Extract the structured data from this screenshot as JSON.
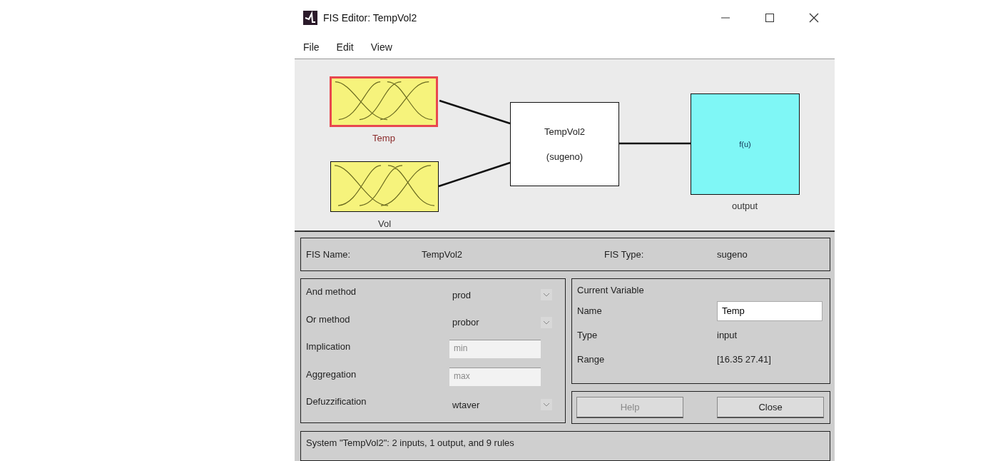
{
  "window": {
    "title": "FIS Editor: TempVol2"
  },
  "menu": [
    "File",
    "Edit",
    "View"
  ],
  "diagram": {
    "inputs": [
      {
        "name": "Temp",
        "selected": true
      },
      {
        "name": "Vol",
        "selected": false
      }
    ],
    "system": {
      "name": "TempVol2",
      "type": "(sugeno)"
    },
    "output": {
      "function": "f(u)",
      "name": "output",
      "selected": false
    }
  },
  "fis": {
    "name_label": "FIS Name:",
    "name": "TempVol2",
    "type_label": "FIS Type:",
    "type": "sugeno"
  },
  "methods": [
    {
      "label": "And method",
      "value": "prod",
      "disabled": false
    },
    {
      "label": "Or method",
      "value": "probor",
      "disabled": false
    },
    {
      "label": "Implication",
      "value": "min",
      "disabled": true
    },
    {
      "label": "Aggregation",
      "value": "max",
      "disabled": true
    },
    {
      "label": "Defuzzification",
      "value": "wtaver",
      "disabled": false
    }
  ],
  "current_variable": {
    "title": "Current Variable",
    "name_label": "Name",
    "name": "Temp",
    "type_label": "Type",
    "type": "input",
    "range_label": "Range",
    "range": "[16.35 27.41]"
  },
  "buttons": [
    {
      "label": "Help",
      "disabled": true
    },
    {
      "label": "Close",
      "disabled": false
    }
  ],
  "status": "System \"TempVol2\": 2 inputs, 1 output, and 9 rules"
}
